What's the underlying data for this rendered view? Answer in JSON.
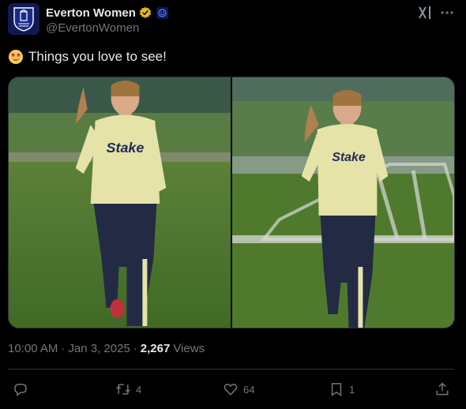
{
  "author": {
    "display_name": "Everton Women",
    "handle": "@EvertonWomen",
    "avatar_icon": "everton-crest-icon",
    "verified_icon": "gold-verified-badge-icon",
    "affiliation_icon": "affiliate-badge-icon"
  },
  "tweet": {
    "emoji": "star-struck-emoji",
    "text": "Things you love to see!"
  },
  "media": {
    "photos": [
      {
        "alt": "player-running-photo-1"
      },
      {
        "alt": "player-running-photo-2"
      }
    ],
    "kit_text": "Stake"
  },
  "meta": {
    "time": "10:00 AM",
    "separator": "·",
    "date": "Jan 3, 2025",
    "separator2": "·",
    "views_count": "2,267",
    "views_label": "Views"
  },
  "actions": {
    "reply_count": "",
    "retweet_count": "4",
    "like_count": "64",
    "bookmark_count": "1"
  },
  "colors": {
    "background": "#000000",
    "text": "#e7e9ea",
    "muted": "#71767b",
    "border": "#2f3336",
    "brand_blue": "#0f1a54",
    "verified_gold": "#e2b719"
  }
}
